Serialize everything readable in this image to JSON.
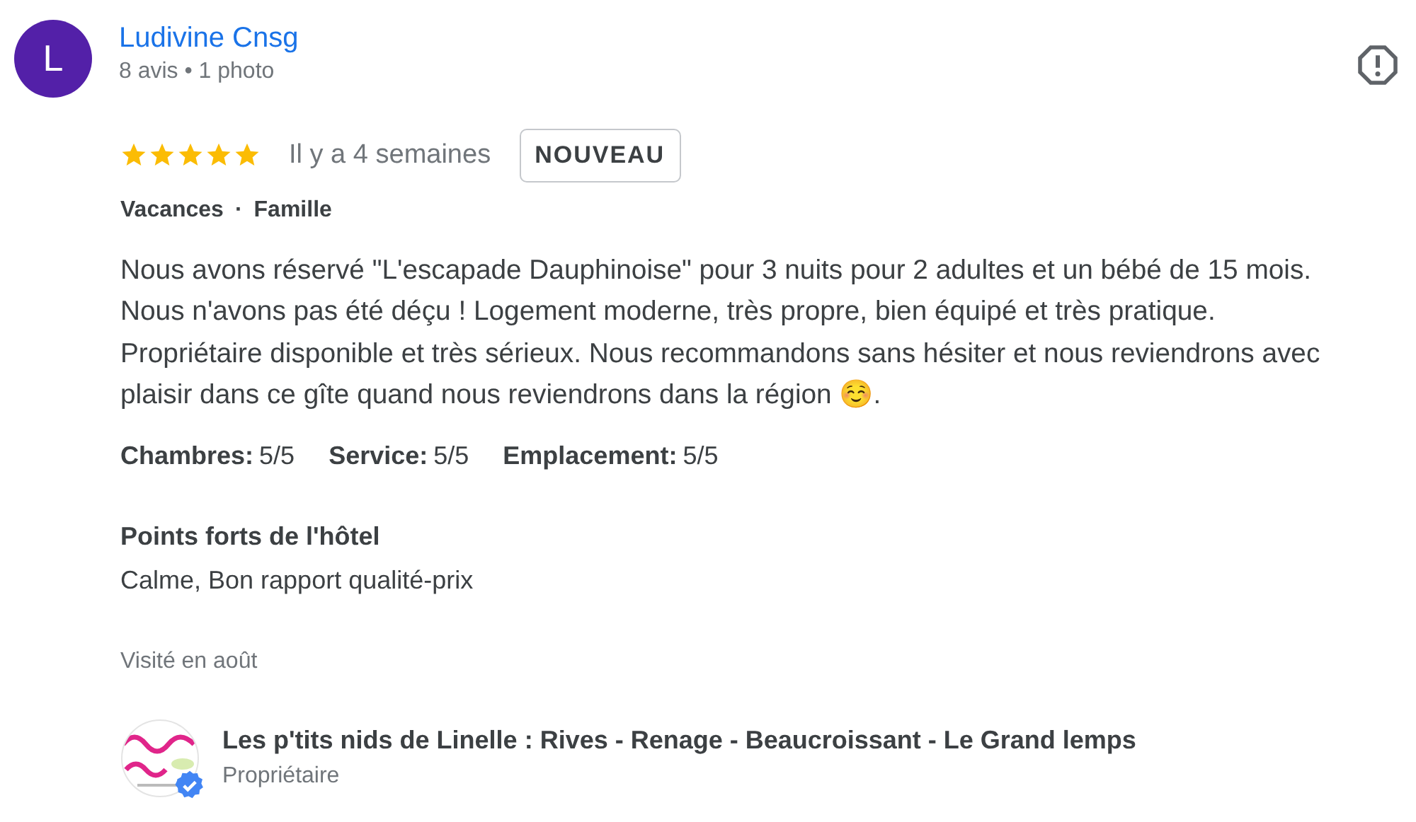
{
  "reviewer": {
    "initial": "L",
    "name": "Ludivine Cnsg",
    "meta": "8 avis • 1 photo"
  },
  "review": {
    "stars": 5,
    "time": "Il y a 4 semaines",
    "badge": "NOUVEAU",
    "tags": [
      "Vacances",
      "Famille"
    ],
    "tag_separator": "·",
    "text": "Nous avons réservé \"L'escapade Dauphinoise\" pour 3 nuits pour 2 adultes et un bébé de 15 mois. Nous n'avons pas été déçu ! Logement moderne, très propre, bien équipé et très pratique. Propriétaire disponible et très sérieux. Nous recommandons sans hésiter et nous reviendrons avec plaisir dans ce gîte quand nous reviendrons dans la région ☺️.",
    "ratings": [
      {
        "label": "Chambres:",
        "value": "5/5"
      },
      {
        "label": "Service:",
        "value": "5/5"
      },
      {
        "label": "Emplacement:",
        "value": "5/5"
      }
    ],
    "highlights": {
      "title": "Points forts de l'hôtel",
      "value": "Calme, Bon rapport qualité-prix"
    },
    "visited": "Visité en août"
  },
  "owner": {
    "name": "Les p'tits nids de Linelle : Rives - Renage - Beaucroissant - Le Grand lemps",
    "role": "Propriétaire",
    "verified": true
  }
}
